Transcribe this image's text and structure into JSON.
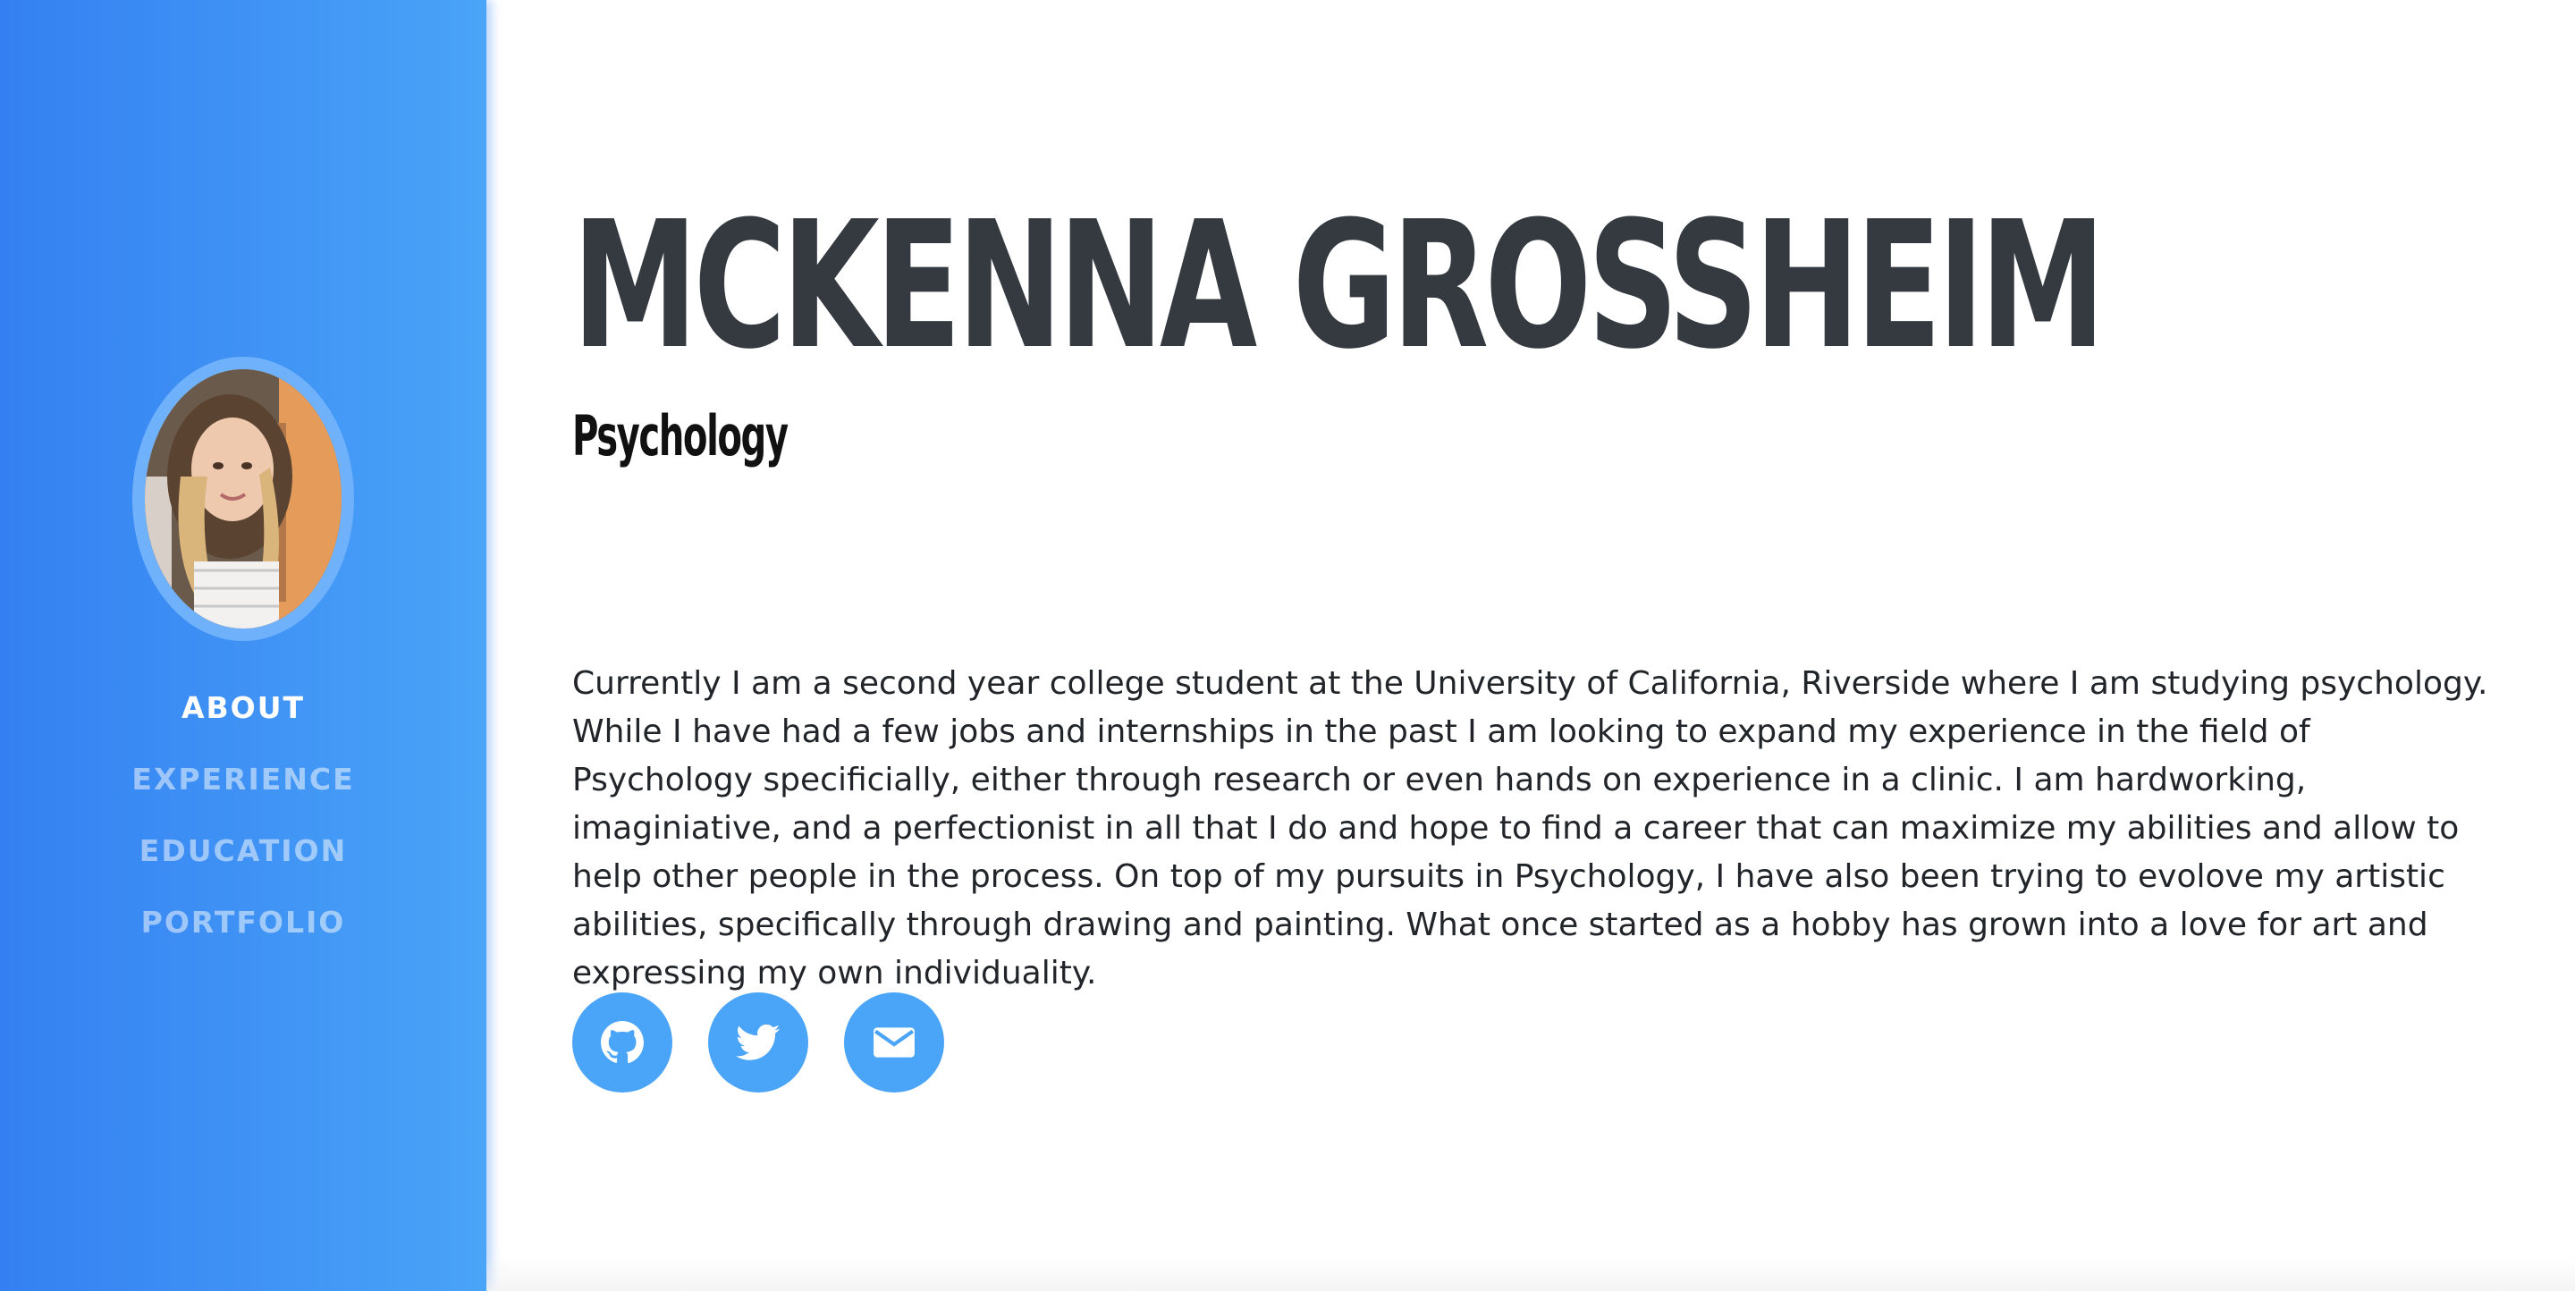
{
  "profile": {
    "name": "MCKENNA GROSSHEIM",
    "subtitle": "Psychology",
    "bio": "Currently I am a second year college student at the University of California, Riverside where I am studying psychology. While I have had a few jobs and internships in the past I am looking to expand my experience in the field of Psychology specificially, either through research or even hands on experience in a clinic. I am hardworking, imaginiative, and a perfectionist in all that I do and hope to find a career that can maximize my abilities and allow to help other people in the process. On top of my pursuits in Psychology, I have also been trying to evolove my artistic abilities, specifically through drawing and painting. What once started as a hobby has grown into a love for art and expressing my own individuality."
  },
  "sidebar": {
    "items": [
      {
        "label": "ABOUT",
        "active": true
      },
      {
        "label": "EXPERIENCE",
        "active": false
      },
      {
        "label": "EDUCATION",
        "active": false
      },
      {
        "label": "PORTFOLIO",
        "active": false
      }
    ]
  },
  "social": [
    {
      "icon": "github-icon"
    },
    {
      "icon": "twitter-icon"
    },
    {
      "icon": "envelope-icon"
    }
  ],
  "colors": {
    "sidebar_start": "#3480f2",
    "sidebar_end": "#4aa4f7",
    "accent": "#4aa4f7",
    "heading": "#343a40",
    "text": "#212529"
  }
}
